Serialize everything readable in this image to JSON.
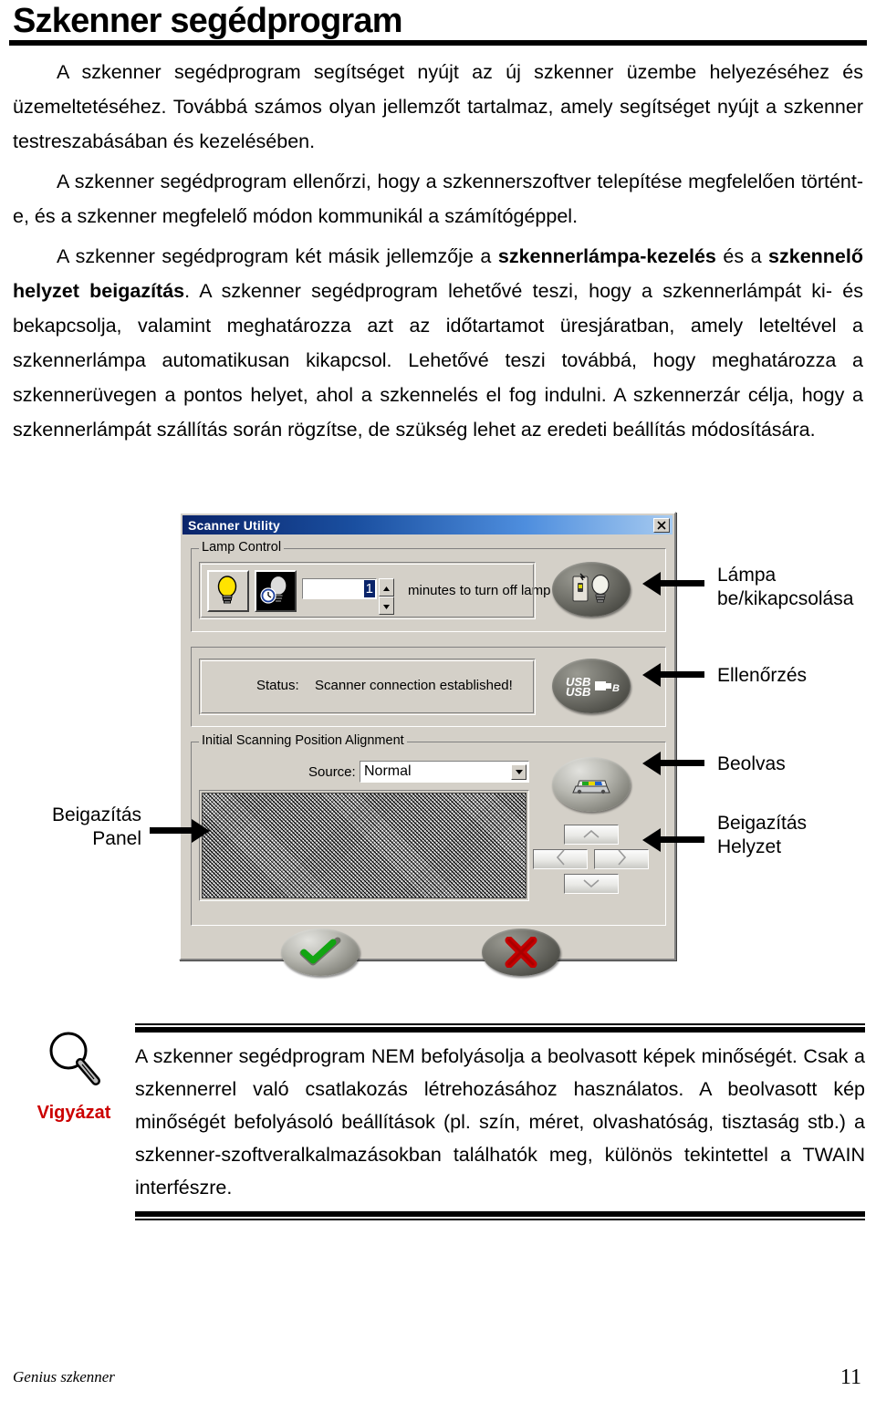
{
  "document": {
    "heading": "Szkenner segédprogram",
    "paragraphs": [
      {
        "id": "p1",
        "runs": [
          {
            "text": "A szkenner segédprogram segítséget nyújt az új szkenner üzembe helyezéséhez és üzemeltetéséhez. Továbbá számos olyan  jellemzőt tartalmaz, amely segítséget nyújt a szkenner testreszabásában és kezelésében.",
            "bold": false
          }
        ]
      },
      {
        "id": "p2",
        "runs": [
          {
            "text": "A   szkenner segédprogram ellenőrzi, hogy a szkennerszoftver telepítése megfelelően történt-e, és a szkenner megfelelő módon kommunikál a számítógéppel.",
            "bold": false
          }
        ]
      },
      {
        "id": "p3",
        "runs": [
          {
            "text": "A szkenner segédprogram két másik jellemzője a ",
            "bold": false
          },
          {
            "text": "szkennerlámpa-kezelés",
            "bold": true
          },
          {
            "text": " és a ",
            "bold": false
          },
          {
            "text": "szkennelő helyzet beigazítás",
            "bold": true
          },
          {
            "text": ". A szkenner segédprogram lehetővé teszi, hogy a szkennerlámpát ki- és bekapcsolja, valamint meghatározza azt az időtartamot üresjáratban, amely leteltével a szkennerlámpa automatikusan kikapcsol. Lehetővé teszi továbbá, hogy meghatározza a szkennerüvegen a pontos helyet, ahol a szkennelés el fog indulni. A szkennerzár  célja, hogy a szkennerlámpát szállítás során rögzítse,  de szükség lehet az eredeti beállítás módosítására.",
            "bold": false
          }
        ]
      }
    ]
  },
  "dialog": {
    "title": "Scanner Utility",
    "close_icon": "close-icon",
    "lamp_control": {
      "legend": "Lamp Control",
      "lamp_on_icon": "lightbulb-on-icon",
      "lamp_timer_icon": "lightbulb-clock-icon",
      "minutes_value": "1",
      "minutes_label": "minutes to turn off lamp",
      "spin_up_icon": "triangle-up-icon",
      "spin_down_icon": "triangle-down-icon",
      "action_icon": "lamp-switch-icon"
    },
    "status": {
      "label": "Status:",
      "message": "Scanner connection established!",
      "action_icon": "usb-logo-icon"
    },
    "alignment": {
      "legend": "Initial Scanning Position Alignment",
      "source_label": "Source:",
      "source_value": "Normal",
      "source_options": [
        "Normal"
      ],
      "combo_arrow_icon": "chevron-down-icon",
      "action_icon": "scanner-icon",
      "pad": {
        "up_icon": "arrow-up-icon",
        "left_icon": "arrow-left-icon",
        "right_icon": "arrow-right-icon",
        "down_icon": "arrow-down-icon"
      },
      "preview_name": "alignment-preview-area"
    },
    "footer_buttons": {
      "ok_icon": "green-check-icon",
      "cancel_icon": "red-x-icon"
    }
  },
  "callouts": {
    "lamp_toggle_line1": "Lámpa",
    "lamp_toggle_line2": "be/kikapcsolása",
    "check": "Ellenőrzés",
    "scan": "Beolvas",
    "align_pos_line1": "Beigazítás",
    "align_pos_line2": "Helyzet",
    "align_panel_line1": "Beigazítás",
    "align_panel_line2": "Panel"
  },
  "warning": {
    "icon": "magnifier-icon",
    "label": "Vigyázat",
    "text": "A szkenner segédprogram NEM befolyásolja a beolvasott képek minőségét. Csak a szkennerrel való csatlakozás létrehozásához használatos. A beolvasott kép minőségét befolyásoló beállítások (pl. szín, méret, olvashatóság, tisztaság stb.) a szkenner-szoftveralkalmazásokban találhatók meg, különös tekintettel a TWAIN interfészre."
  },
  "footer": {
    "left": "Genius szkenner",
    "page_number": "11"
  },
  "colors": {
    "warning_label": "#cc0000",
    "dialog_face": "#d4d0c8",
    "titlebar_start": "#0a246a",
    "titlebar_end": "#a6caf0",
    "ok_check": "#12a512",
    "cancel_x": "#c40000"
  }
}
